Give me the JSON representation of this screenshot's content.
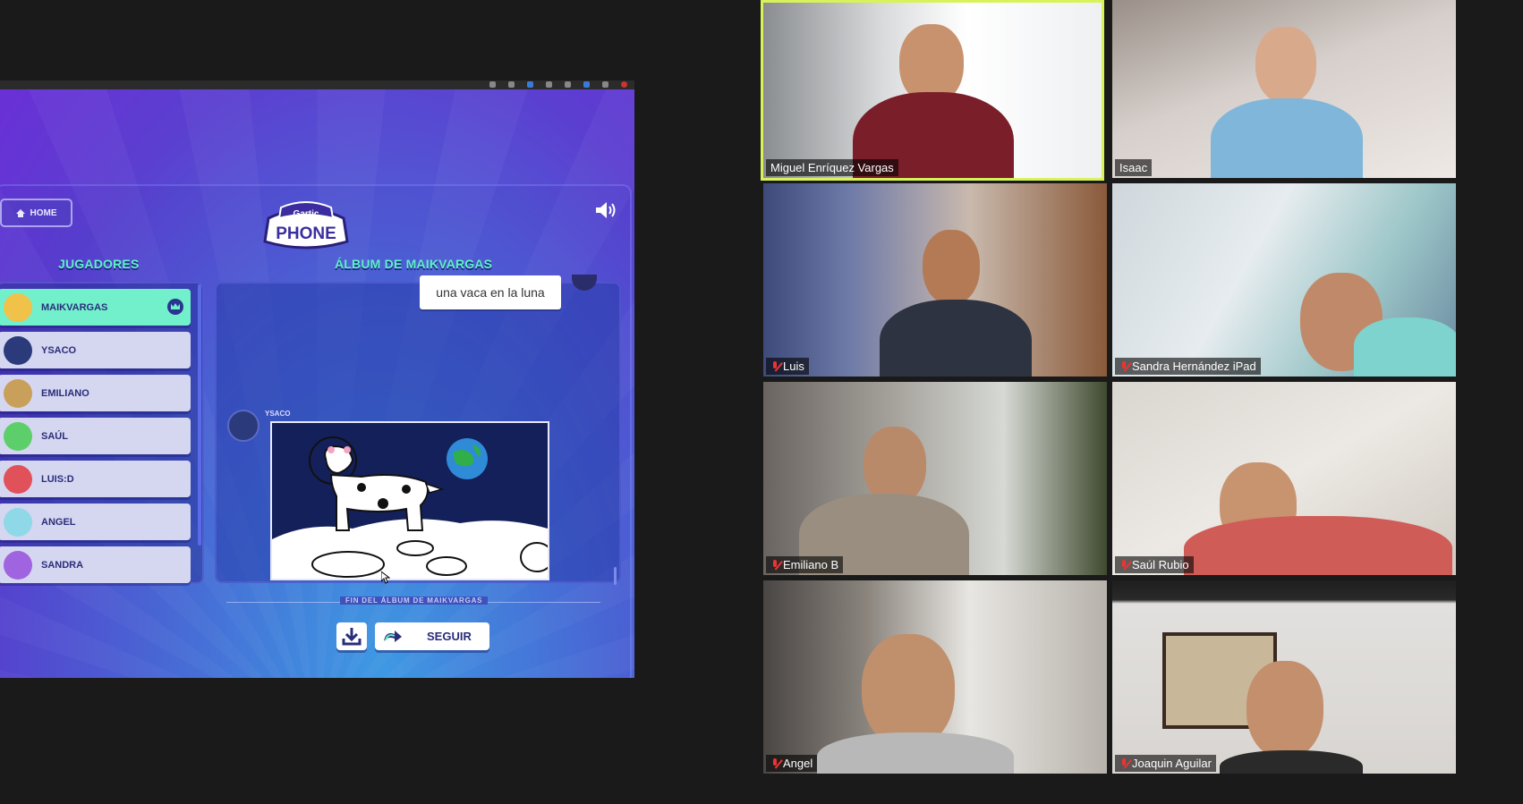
{
  "game": {
    "home_label": "HOME",
    "players_title": "JUGADORES",
    "album_title": "ÁLBUM DE MAIKVARGAS",
    "players": [
      {
        "name": "MAIKVARGAS",
        "active": true,
        "avatar_color": "#f0c24a"
      },
      {
        "name": "YSACO",
        "active": false,
        "avatar_color": "#2b3a7a"
      },
      {
        "name": "EMILIANO",
        "active": false,
        "avatar_color": "#c9a05a"
      },
      {
        "name": "SAÚL",
        "active": false,
        "avatar_color": "#5ccf6a"
      },
      {
        "name": "LUIS:D",
        "active": false,
        "avatar_color": "#e0515a"
      },
      {
        "name": "ANGEL",
        "active": false,
        "avatar_color": "#8fd8e8"
      },
      {
        "name": "SANDRA",
        "active": false,
        "avatar_color": "#a064e0"
      }
    ],
    "caption_text": "una vaca en la luna",
    "drawer_name": "YSACO",
    "end_label": "FIN DEL ÁLBUM DE MAIKVARGAS",
    "continue_label": "SEGUIR",
    "logo_top": "Gartic",
    "logo_bottom": "PHONE"
  },
  "participants": [
    {
      "name": "Miguel Enríquez Vargas",
      "muted": false,
      "active_speaker": true
    },
    {
      "name": "Isaac",
      "muted": false,
      "active_speaker": false
    },
    {
      "name": "Luis",
      "muted": true,
      "active_speaker": false
    },
    {
      "name": "Sandra Hernández iPad",
      "muted": true,
      "active_speaker": false
    },
    {
      "name": "Emiliano B",
      "muted": true,
      "active_speaker": false
    },
    {
      "name": "Saúl Rubio",
      "muted": true,
      "active_speaker": false
    },
    {
      "name": "Angel",
      "muted": true,
      "active_speaker": false
    },
    {
      "name": "Joaquin Aguilar",
      "muted": true,
      "active_speaker": false
    }
  ],
  "colors": {
    "accent_teal": "#72f0cc",
    "speaker_highlight": "#d8f35a",
    "mute_red": "#e33333"
  }
}
